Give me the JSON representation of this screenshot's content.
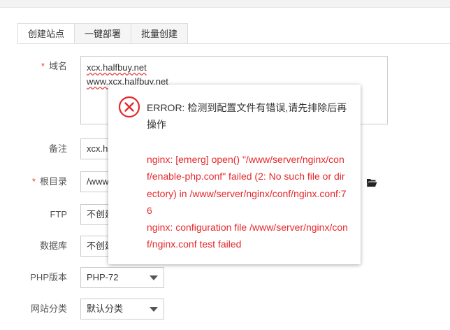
{
  "tabs": [
    {
      "label": "创建站点",
      "active": true
    },
    {
      "label": "一键部署",
      "active": false
    },
    {
      "label": "批量创建",
      "active": false
    }
  ],
  "form": {
    "required_mark": "*",
    "domain": {
      "label": "域名",
      "lines": [
        "xcx.halfbuy.net",
        "www.xcx.halfbuy.net"
      ]
    },
    "remark": {
      "label": "备注",
      "value": "xcx.ha"
    },
    "root_dir": {
      "label": "根目录",
      "value": "/www",
      "icon": "folder-open-icon"
    },
    "ftp": {
      "label": "FTP",
      "value": "不创建"
    },
    "database": {
      "label": "数据库",
      "value": "不创建"
    },
    "php_version": {
      "label": "PHP版本",
      "value": "PHP-72"
    },
    "site_category": {
      "label": "网站分类",
      "value": "默认分类"
    }
  },
  "modal": {
    "icon": "error-circle-x-icon",
    "title": "ERROR: 检测到配置文件有错误,请先排除后再操作",
    "message_lines": [
      "nginx: [emerg] open() \"/www/server/nginx/conf/enable-php.conf\" failed (2: No such file or directory) in /www/server/nginx/conf/nginx.conf:76",
      "nginx: configuration file /www/server/nginx/conf/nginx.conf test failed"
    ]
  },
  "colors": {
    "error": "#e5282b",
    "required": "#e5482e"
  }
}
